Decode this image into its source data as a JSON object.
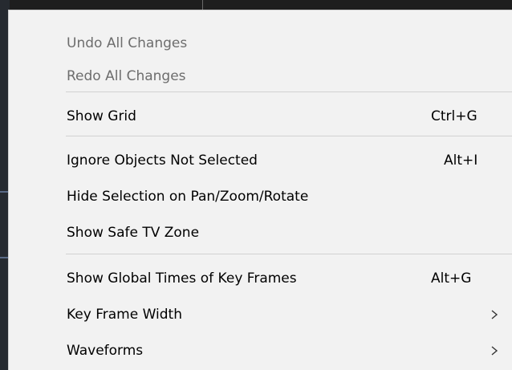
{
  "menu": {
    "items": [
      {
        "label": "Undo All Changes",
        "shortcut": "",
        "enabled": false
      },
      {
        "label": "Redo All Changes",
        "shortcut": "",
        "enabled": false
      },
      {
        "label": "Show Grid",
        "shortcut": "Ctrl+G",
        "enabled": true
      },
      {
        "label": "Ignore Objects Not Selected",
        "shortcut": "Alt+I",
        "enabled": true
      },
      {
        "label": "Hide Selection on Pan/Zoom/Rotate",
        "shortcut": "",
        "enabled": true
      },
      {
        "label": "Show Safe TV Zone",
        "shortcut": "",
        "enabled": true
      },
      {
        "label": "Show Global Times of Key Frames",
        "shortcut": "Alt+G",
        "enabled": true
      },
      {
        "label": "Key Frame Width",
        "shortcut": "",
        "enabled": true,
        "submenu_icon": "chevron-right-icon"
      },
      {
        "label": "Waveforms",
        "shortcut": "",
        "enabled": true,
        "submenu_icon": "chevron-right-icon"
      }
    ]
  },
  "colors": {
    "menu_background": "#f2f2f2",
    "disabled_text": "#6d6d6d",
    "enabled_text": "#000000",
    "separator": "#d2d2d2"
  }
}
